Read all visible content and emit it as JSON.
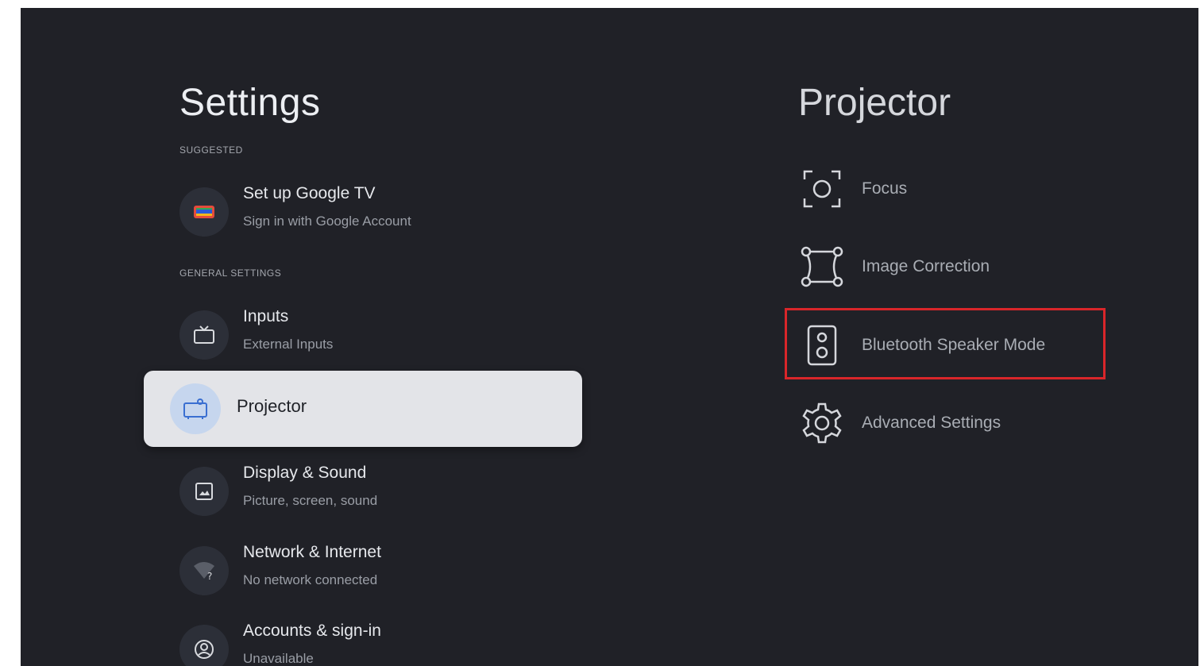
{
  "settings": {
    "title": "Settings",
    "suggested_label": "SUGGESTED",
    "general_label": "GENERAL SETTINGS",
    "items": [
      {
        "title": "Set up Google TV",
        "subtitle": "Sign in with Google Account",
        "icon": "google-tv-icon"
      },
      {
        "title": "Inputs",
        "subtitle": "External Inputs",
        "icon": "tv-icon"
      },
      {
        "title": "Projector",
        "subtitle": "",
        "icon": "projector-icon",
        "selected": true
      },
      {
        "title": "Display & Sound",
        "subtitle": "Picture, screen, sound",
        "icon": "picture-icon"
      },
      {
        "title": "Network & Internet",
        "subtitle": "No network connected",
        "icon": "wifi-unknown-icon"
      },
      {
        "title": "Accounts & sign-in",
        "subtitle": "Unavailable",
        "icon": "account-icon"
      }
    ]
  },
  "panel": {
    "title": "Projector",
    "items": [
      {
        "label": "Focus",
        "icon": "focus-icon"
      },
      {
        "label": "Image Correction",
        "icon": "keystone-icon"
      },
      {
        "label": "Bluetooth Speaker Mode",
        "icon": "speaker-icon",
        "highlighted": true
      },
      {
        "label": "Advanced Settings",
        "icon": "gear-icon"
      }
    ]
  },
  "colors": {
    "background": "#202127",
    "selected_item": "#e3e4e8",
    "highlight_border": "#d9262a"
  }
}
